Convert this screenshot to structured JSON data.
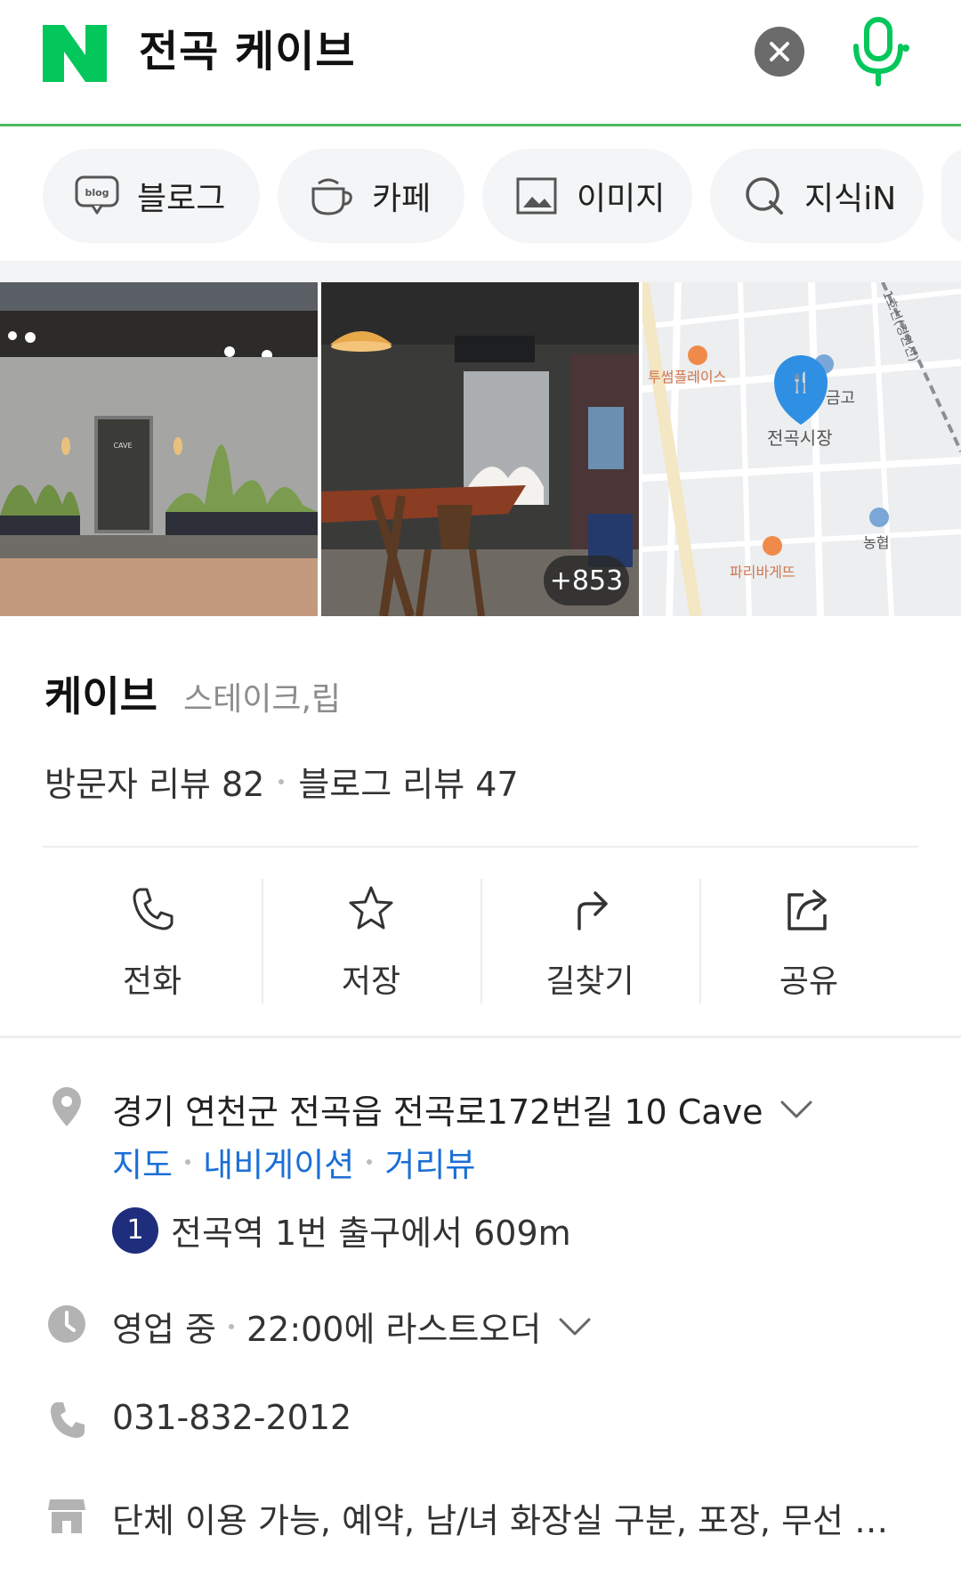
{
  "colors": {
    "accent": "#03c75a",
    "link": "#1a6fd6",
    "subway_line_1": "#1e2e7d"
  },
  "search": {
    "query": "전곡 케이브"
  },
  "tabs": [
    {
      "label": "블로그",
      "icon": "blog-icon"
    },
    {
      "label": "카페",
      "icon": "cafe-cup-icon"
    },
    {
      "label": "이미지",
      "icon": "image-icon"
    },
    {
      "label": "지식iN",
      "icon": "kin-icon"
    }
  ],
  "photos": {
    "more_count": "+853"
  },
  "map_labels": {
    "poi_1": "투썸플레이스",
    "poi_2": "금고",
    "poi_3": "전곡시장",
    "poi_4": "농협",
    "poi_5": "파리바게뜨",
    "rail": "1호선(경원선)"
  },
  "place": {
    "name": "케이브",
    "category": "스테이크,립",
    "visitor_reviews": "방문자 리뷰 82",
    "blog_reviews": "블로그 리뷰 47"
  },
  "actions": [
    {
      "label": "전화",
      "icon": "phone-icon"
    },
    {
      "label": "저장",
      "icon": "star-icon"
    },
    {
      "label": "길찾기",
      "icon": "directions-icon"
    },
    {
      "label": "공유",
      "icon": "share-icon"
    }
  ],
  "info": {
    "address": "경기 연천군 전곡읍 전곡로172번길 10 Cave",
    "links": [
      "지도",
      "내비게이션",
      "거리뷰"
    ],
    "subway_line": "1",
    "subway_text": "전곡역 1번 출구에서 609m",
    "status": "영업 중",
    "hours": "22:00에 라스트오더",
    "phone": "031-832-2012",
    "amenities": "단체 이용 가능, 예약, 남/녀 화장실 구분, 포장, 무선 …"
  }
}
